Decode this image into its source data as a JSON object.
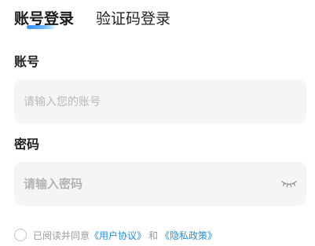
{
  "tabs": {
    "account_login": "账号登录",
    "code_login": "验证码登录"
  },
  "form": {
    "account_label": "账号",
    "account_placeholder": "请输入您的账号",
    "password_label": "密码",
    "password_placeholder": "请输入密码",
    "eye_icon": "eye-closed-icon"
  },
  "agreement": {
    "prefix": "已阅读并同意",
    "user_agreement": "《用户协议》",
    "and": "和",
    "privacy_policy": "《隐私政策》",
    "checked": false
  },
  "colors": {
    "accent": "#2d8ef8",
    "link": "#2b8fd6",
    "input_bg": "#f5f5f5"
  }
}
